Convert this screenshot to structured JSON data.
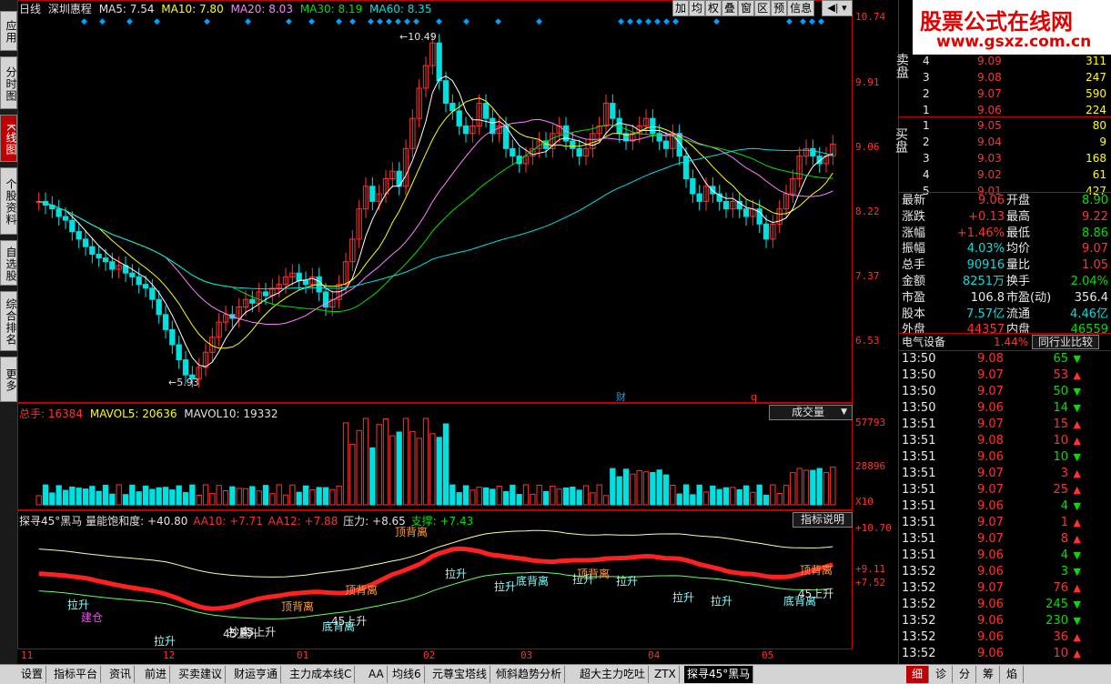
{
  "left_tabs": [
    "应用",
    "分时图",
    "K线图",
    "个股资料",
    "自选股",
    "综合排名",
    "更多"
  ],
  "left_tab_active": 2,
  "header": {
    "period": "日线",
    "stock_name": "深圳惠程",
    "ma5": "MA5: 7.54",
    "ma10": "MA10: 7.80",
    "ma20": "MA20: 8.03",
    "ma30": "MA30: 8.19",
    "ma60": "MA60: 8.35"
  },
  "toolbar": [
    "加",
    "均",
    "权",
    "叠",
    "窗",
    "区",
    "预",
    "信息"
  ],
  "price_axis": [
    "10.74",
    "9.91",
    "9.06",
    "8.22",
    "7.37",
    "6.53"
  ],
  "price_labels": {
    "high": "10.49",
    "low": "5.93",
    "cai": "财",
    "q": "q"
  },
  "volume": {
    "header_total": "总手: 16384",
    "mavol5": "MAVOL5: 20636",
    "mavol10": "MAVOL10: 19332",
    "selector": "成交量",
    "axis": [
      "57793",
      "28896",
      "X10"
    ]
  },
  "indicator": {
    "title": "探寻45°黑马 量能饱和度: +40.80",
    "aa10": "AA10: +7.71",
    "aa12": "AA12: +7.88",
    "pressure": "压力: +8.65",
    "support": "支撑: +7.43",
    "help_button": "指标说明",
    "axis": [
      "+10.70",
      "+9.11",
      "+7.52"
    ],
    "labels": [
      "顶背离",
      "顶背离",
      "顶背离",
      "顶背离",
      "顶背离",
      "底背离",
      "底背离",
      "底背离",
      "拉升",
      "拉升",
      "拉升",
      "拉升",
      "拉升",
      "拉升",
      "拉升",
      "拉升",
      "45上升",
      "45上升",
      "45上升",
      "建仓",
      "抄底",
      "45上升"
    ]
  },
  "x_axis": [
    "11",
    "12",
    "01",
    "02",
    "03",
    "04",
    "05"
  ],
  "watermark": {
    "title": "股票公式在线网",
    "url": "www.gsxz.com.cn"
  },
  "order_book": {
    "sell_label": "卖盘",
    "buy_label": "买盘",
    "sell": [
      {
        "lvl": "4",
        "price": "9.09",
        "vol": "311"
      },
      {
        "lvl": "3",
        "price": "9.08",
        "vol": "247"
      },
      {
        "lvl": "2",
        "price": "9.07",
        "vol": "590"
      },
      {
        "lvl": "1",
        "price": "9.06",
        "vol": "224"
      }
    ],
    "buy": [
      {
        "lvl": "1",
        "price": "9.05",
        "vol": "80"
      },
      {
        "lvl": "2",
        "price": "9.04",
        "vol": "9"
      },
      {
        "lvl": "3",
        "price": "9.03",
        "vol": "168"
      },
      {
        "lvl": "4",
        "price": "9.02",
        "vol": "61"
      },
      {
        "lvl": "5",
        "price": "9.01",
        "vol": "427"
      }
    ]
  },
  "quote": [
    {
      "l": "最新",
      "v": "9.06",
      "l2": "开盘",
      "v2": "8.90"
    },
    {
      "l": "涨跌",
      "v": "+0.13",
      "l2": "最高",
      "v2": "9.22"
    },
    {
      "l": "涨幅",
      "v": "+1.46%",
      "l2": "最低",
      "v2": "8.86"
    },
    {
      "l": "振幅",
      "v": "4.03%",
      "l2": "均价",
      "v2": "9.07"
    },
    {
      "l": "总手",
      "v": "90916",
      "l2": "量比",
      "v2": "1.05"
    },
    {
      "l": "金额",
      "v": "8251万",
      "l2": "换手",
      "v2": "2.04%"
    },
    {
      "l": "市盈",
      "v": "106.8",
      "l2": "市盈(动)",
      "v2": "356.4"
    },
    {
      "l": "股本",
      "v": "7.57亿",
      "l2": "流通",
      "v2": "4.46亿"
    },
    {
      "l": "外盘",
      "v": "44357",
      "l2": "内盘",
      "v2": "46559"
    }
  ],
  "industry": {
    "name": "电气设备",
    "change": "1.44%",
    "compare": "同行业比较"
  },
  "ticks": [
    {
      "t": "13:50",
      "p": "9.08",
      "v": "65",
      "d": "down"
    },
    {
      "t": "13:50",
      "p": "9.07",
      "v": "53",
      "d": "up"
    },
    {
      "t": "13:50",
      "p": "9.07",
      "v": "50",
      "d": "down"
    },
    {
      "t": "13:50",
      "p": "9.06",
      "v": "14",
      "d": "down"
    },
    {
      "t": "13:51",
      "p": "9.07",
      "v": "15",
      "d": "up"
    },
    {
      "t": "13:51",
      "p": "9.08",
      "v": "10",
      "d": "up"
    },
    {
      "t": "13:51",
      "p": "9.06",
      "v": "10",
      "d": "down"
    },
    {
      "t": "13:51",
      "p": "9.07",
      "v": "3",
      "d": "up"
    },
    {
      "t": "13:51",
      "p": "9.07",
      "v": "25",
      "d": "up"
    },
    {
      "t": "13:51",
      "p": "9.06",
      "v": "4",
      "d": "down"
    },
    {
      "t": "13:51",
      "p": "9.07",
      "v": "1",
      "d": "up"
    },
    {
      "t": "13:51",
      "p": "9.07",
      "v": "8",
      "d": "up"
    },
    {
      "t": "13:51",
      "p": "9.06",
      "v": "4",
      "d": "down"
    },
    {
      "t": "13:52",
      "p": "9.06",
      "v": "3",
      "d": "down"
    },
    {
      "t": "13:52",
      "p": "9.07",
      "v": "76",
      "d": "up"
    },
    {
      "t": "13:52",
      "p": "9.06",
      "v": "245",
      "d": "down"
    },
    {
      "t": "13:52",
      "p": "9.06",
      "v": "230",
      "d": "down"
    },
    {
      "t": "13:52",
      "p": "9.06",
      "v": "36",
      "d": "up"
    },
    {
      "t": "13:52",
      "p": "9.06",
      "v": "10",
      "d": "up"
    }
  ],
  "bottom_tabs": [
    "设置",
    "指标平台",
    "资讯",
    "前进",
    "买卖建议",
    "财运亨通",
    "主力成本线C",
    "AA",
    "均线6",
    "元尊宝塔线",
    "倾斜趋势分析",
    "超大主力吃吐",
    "ZTX",
    "探寻45°黑马"
  ],
  "bottom_active": 13,
  "right_tabs": [
    "细",
    "诊",
    "分",
    "筹",
    "焰"
  ],
  "right_tab_active": 0
}
